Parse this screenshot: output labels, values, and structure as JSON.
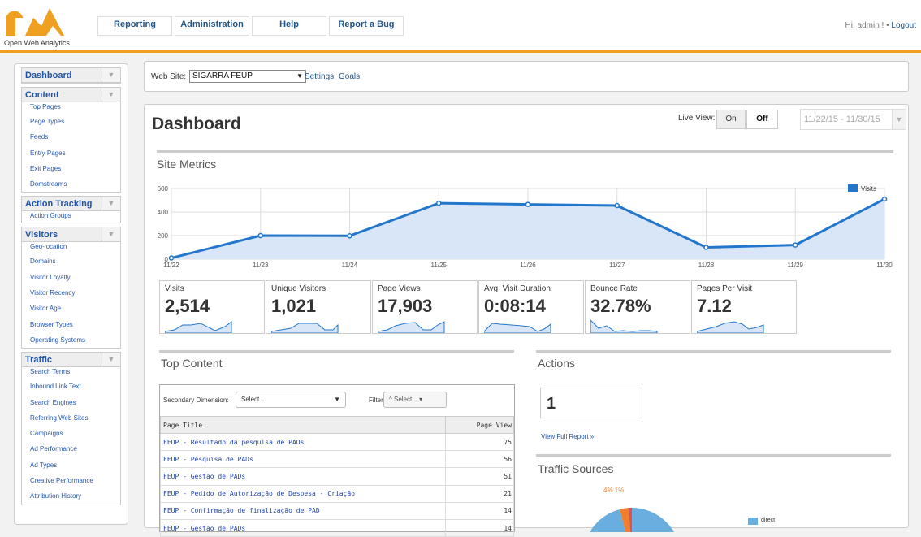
{
  "app": {
    "logo_text": "Open Web Analytics",
    "nav": [
      "Reporting",
      "Administration",
      "Help",
      "Report a Bug"
    ],
    "greeting": "Hi, admin ! •",
    "logout": "Logout",
    "accent_color": "#f0a020"
  },
  "sidebar": {
    "sections": [
      {
        "title": "Dashboard",
        "items": []
      },
      {
        "title": "Content",
        "items": [
          "Top Pages",
          "Page Types",
          "Feeds",
          "Entry Pages",
          "Exit Pages",
          "Domstreams"
        ]
      },
      {
        "title": "Action Tracking",
        "items": [
          "Action Groups"
        ]
      },
      {
        "title": "Visitors",
        "items": [
          "Geo-location",
          "Domains",
          "Visitor Loyalty",
          "Visitor Recency",
          "Visitor Age",
          "Browser Types",
          "Operating Systems"
        ]
      },
      {
        "title": "Traffic",
        "items": [
          "Search Terms",
          "Inbound Link Text",
          "Search Engines",
          "Referring Web Sites",
          "Campaigns",
          "Ad Performance",
          "Ad Types",
          "Creative Performance",
          "Attribution History"
        ]
      }
    ]
  },
  "website": {
    "label": "Web Site:",
    "selected": "SIGARRA FEUP",
    "settings": "Settings",
    "goals": "Goals"
  },
  "dashboard": {
    "title": "Dashboard",
    "live_view_label": "Live View:",
    "on": "On",
    "off": "Off",
    "date_range": "11/22/15 - 11/30/15",
    "site_metrics_title": "Site Metrics"
  },
  "chart_data": {
    "type": "area",
    "x": [
      "11/22",
      "11/23",
      "11/24",
      "11/25",
      "11/26",
      "11/27",
      "11/28",
      "11/29",
      "11/30"
    ],
    "series": [
      {
        "name": "Visits",
        "values": [
          10,
          200,
          198,
          475,
          465,
          455,
          100,
          120,
          510
        ]
      }
    ],
    "ylim": [
      0,
      600
    ],
    "yticks": [
      0,
      200,
      400,
      600
    ],
    "legend_position": "top-right",
    "grid": true,
    "line_color": "#2277cc",
    "fill_color": "#d8e6f7"
  },
  "metrics": [
    {
      "label": "Visits",
      "value": "2,514"
    },
    {
      "label": "Unique Visitors",
      "value": "1,021"
    },
    {
      "label": "Page Views",
      "value": "17,903"
    },
    {
      "label": "Avg. Visit Duration",
      "value": "0:08:14"
    },
    {
      "label": "Bounce Rate",
      "value": "32.78%"
    },
    {
      "label": "Pages Per Visit",
      "value": "7.12"
    }
  ],
  "top_content": {
    "title": "Top Content",
    "secondary_dimension_label": "Secondary Dimension:",
    "secondary_dimension_value": "Select...",
    "filter_label": "Filter:",
    "filter_value": "^ Select... ▾",
    "columns": [
      "Page Title",
      "Page View"
    ],
    "rows": [
      {
        "title": "FEUP - Resultado da pesquisa de PADs",
        "views": "75"
      },
      {
        "title": "FEUP - Pesquisa de PADs",
        "views": "56"
      },
      {
        "title": "FEUP - Gestão de PADs",
        "views": "51"
      },
      {
        "title": "FEUP - Pedido de Autorização de Despesa - Criação",
        "views": "21"
      },
      {
        "title": "FEUP - Confirmação de finalização de PAD",
        "views": "14"
      },
      {
        "title": "FEUP - Gestão de PADs",
        "views": "14"
      }
    ]
  },
  "actions": {
    "title": "Actions",
    "count": "1",
    "view_full_report": "View Full Report »"
  },
  "traffic_sources": {
    "title": "Traffic Sources",
    "labels": "4% 1%",
    "legend_item": "direct"
  }
}
